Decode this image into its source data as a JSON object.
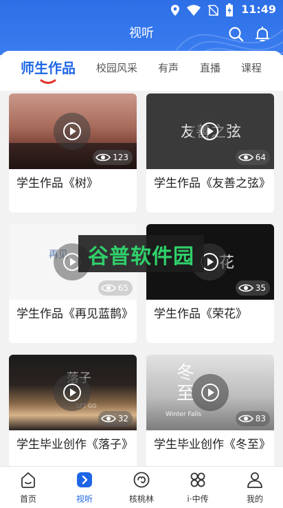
{
  "status_bar": {
    "time": "11:49"
  },
  "header": {
    "title": "视听",
    "search_icon": "search-icon",
    "bell_icon": "bell-icon"
  },
  "tabs": [
    {
      "label": "师生作品",
      "active": true
    },
    {
      "label": "校园风采",
      "active": false
    },
    {
      "label": "有声",
      "active": false
    },
    {
      "label": "直播",
      "active": false
    },
    {
      "label": "课程",
      "active": false
    }
  ],
  "videos": [
    {
      "title": "学生作品《树》",
      "views": "123"
    },
    {
      "title": "学生作品《友善之弦》",
      "views": "64",
      "thumb_text": "友善之弦"
    },
    {
      "title": "学生作品《再见蓝鹊》",
      "views": "65",
      "thumb_text": "再见"
    },
    {
      "title": "学生作品《荣花》",
      "views": "35",
      "thumb_text": "花"
    },
    {
      "title": "学生毕业创作《落子》",
      "views": "32",
      "thumb_text": "落子",
      "thumb_subtext": "LET GO"
    },
    {
      "title": "学生毕业创作《冬至》",
      "views": "83",
      "thumb_text": "冬至",
      "thumb_subtext": "Winter Falls"
    }
  ],
  "watermark": {
    "text": "谷普软件园"
  },
  "bottom_nav": [
    {
      "label": "首页",
      "icon": "home-icon",
      "active": false
    },
    {
      "label": "视听",
      "icon": "play-square-icon",
      "active": true
    },
    {
      "label": "核桃林",
      "icon": "walnut-icon",
      "active": false
    },
    {
      "label": "i·中传",
      "icon": "grid-icon",
      "active": false
    },
    {
      "label": "我的",
      "icon": "person-icon",
      "active": false
    }
  ],
  "colors": {
    "accent": "#1e66e6",
    "header": "#3a7df0",
    "tab_underline": "#e0342b"
  }
}
